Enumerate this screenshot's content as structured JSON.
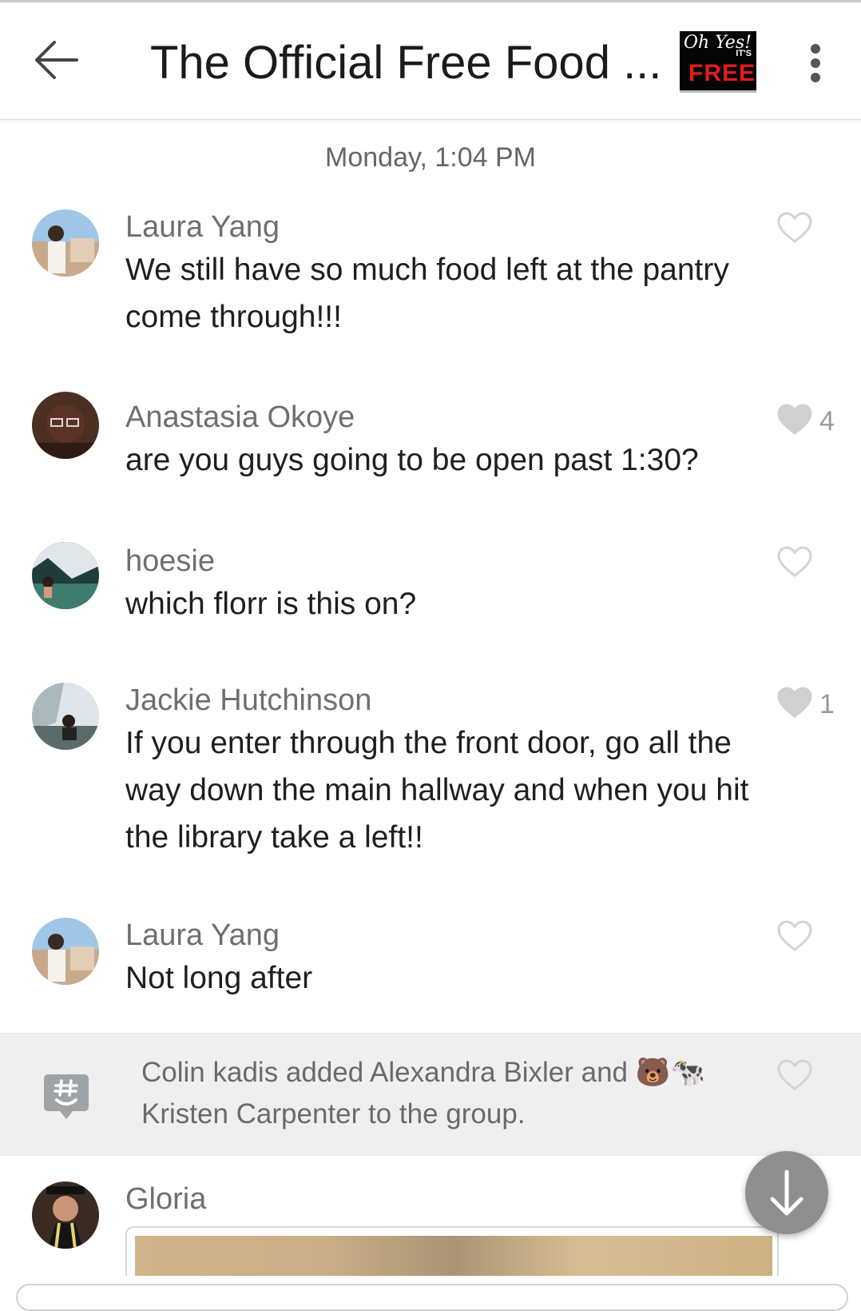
{
  "header": {
    "title": "The Official Free Food ...",
    "logo_text_top": "Oh Yes!",
    "logo_text_its": "IT'S",
    "logo_text_free": "FREE"
  },
  "date_separator": "Monday, 1:04 PM",
  "messages": [
    {
      "author": "Laura Yang",
      "text": "We still have so much food left at the pantry come through!!!",
      "likes": "",
      "liked": false
    },
    {
      "author": "Anastasia Okoye",
      "text": "are you guys going to be open past 1:30?",
      "likes": "4",
      "liked": true
    },
    {
      "author": "hoesie",
      "text": "which florr is this on?",
      "likes": "",
      "liked": false
    },
    {
      "author": "Jackie Hutchinson",
      "text": "If you enter through the front door, go all the way down the main hallway and when you hit the library take a left!!",
      "likes": "1",
      "liked": true
    },
    {
      "author": "Laura Yang",
      "text": "Not long after",
      "likes": "",
      "liked": false
    }
  ],
  "system_message": {
    "text": "Colin kadis added Alexandra Bixler and 🐻🐄 Kristen Carpenter to the group."
  },
  "last_message": {
    "author": "Gloria"
  },
  "icons": {
    "back": "arrow-left-icon",
    "menu": "more-vertical-icon",
    "heart": "heart-icon",
    "scroll": "arrow-down-icon",
    "system": "groupme-hashtag-icon"
  },
  "colors": {
    "liked_heart": "#d0d0d0",
    "unliked_heart_stroke": "#d3d3d3",
    "scroll_button": "#8f8f8f",
    "system_bg": "#efefef"
  }
}
